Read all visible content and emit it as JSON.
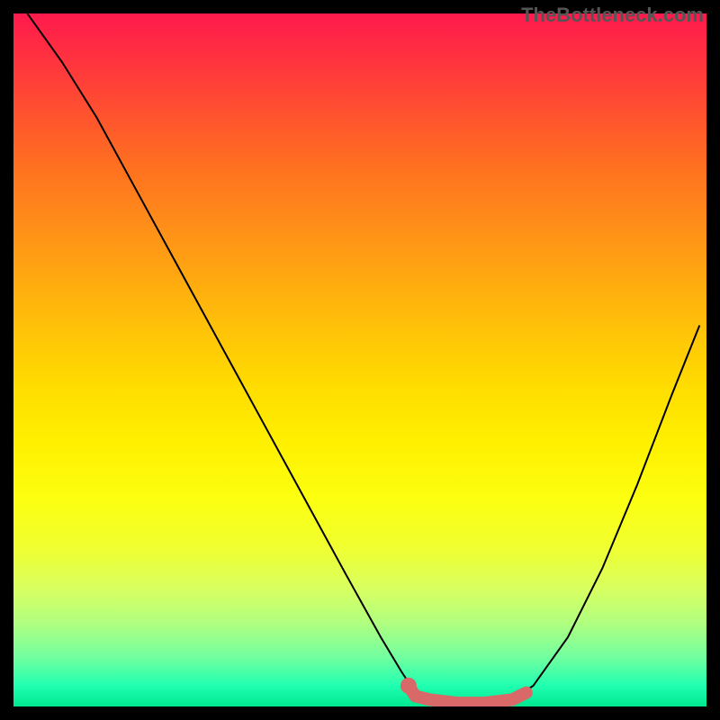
{
  "watermark": "TheBottleneck.com",
  "chart_data": {
    "type": "line",
    "title": "",
    "xlabel": "",
    "ylabel": "",
    "xlim": [
      0,
      100
    ],
    "ylim": [
      0,
      100
    ],
    "series": [
      {
        "name": "bottleneck-curve",
        "type": "line",
        "color": "#000000",
        "points": [
          {
            "x": 2,
            "y": 100
          },
          {
            "x": 7,
            "y": 93
          },
          {
            "x": 12,
            "y": 85
          },
          {
            "x": 18,
            "y": 74
          },
          {
            "x": 24,
            "y": 63
          },
          {
            "x": 30,
            "y": 52
          },
          {
            "x": 36,
            "y": 41
          },
          {
            "x": 42,
            "y": 30
          },
          {
            "x": 48,
            "y": 19
          },
          {
            "x": 53,
            "y": 10
          },
          {
            "x": 56,
            "y": 5
          },
          {
            "x": 58,
            "y": 2
          },
          {
            "x": 60,
            "y": 1
          },
          {
            "x": 64,
            "y": 0.5
          },
          {
            "x": 68,
            "y": 0.5
          },
          {
            "x": 72,
            "y": 1
          },
          {
            "x": 75,
            "y": 3
          },
          {
            "x": 80,
            "y": 10
          },
          {
            "x": 85,
            "y": 20
          },
          {
            "x": 90,
            "y": 32
          },
          {
            "x": 95,
            "y": 45
          },
          {
            "x": 99,
            "y": 55
          }
        ]
      },
      {
        "name": "highlight-segment",
        "type": "line",
        "color": "#d96868",
        "stroke_width": 10,
        "points": [
          {
            "x": 57,
            "y": 3
          },
          {
            "x": 58,
            "y": 1.5
          },
          {
            "x": 60,
            "y": 1
          },
          {
            "x": 64,
            "y": 0.5
          },
          {
            "x": 68,
            "y": 0.5
          },
          {
            "x": 72,
            "y": 1
          },
          {
            "x": 74,
            "y": 2
          }
        ]
      },
      {
        "name": "highlight-dot",
        "type": "scatter",
        "color": "#d96868",
        "points": [
          {
            "x": 57,
            "y": 3
          }
        ]
      }
    ]
  }
}
